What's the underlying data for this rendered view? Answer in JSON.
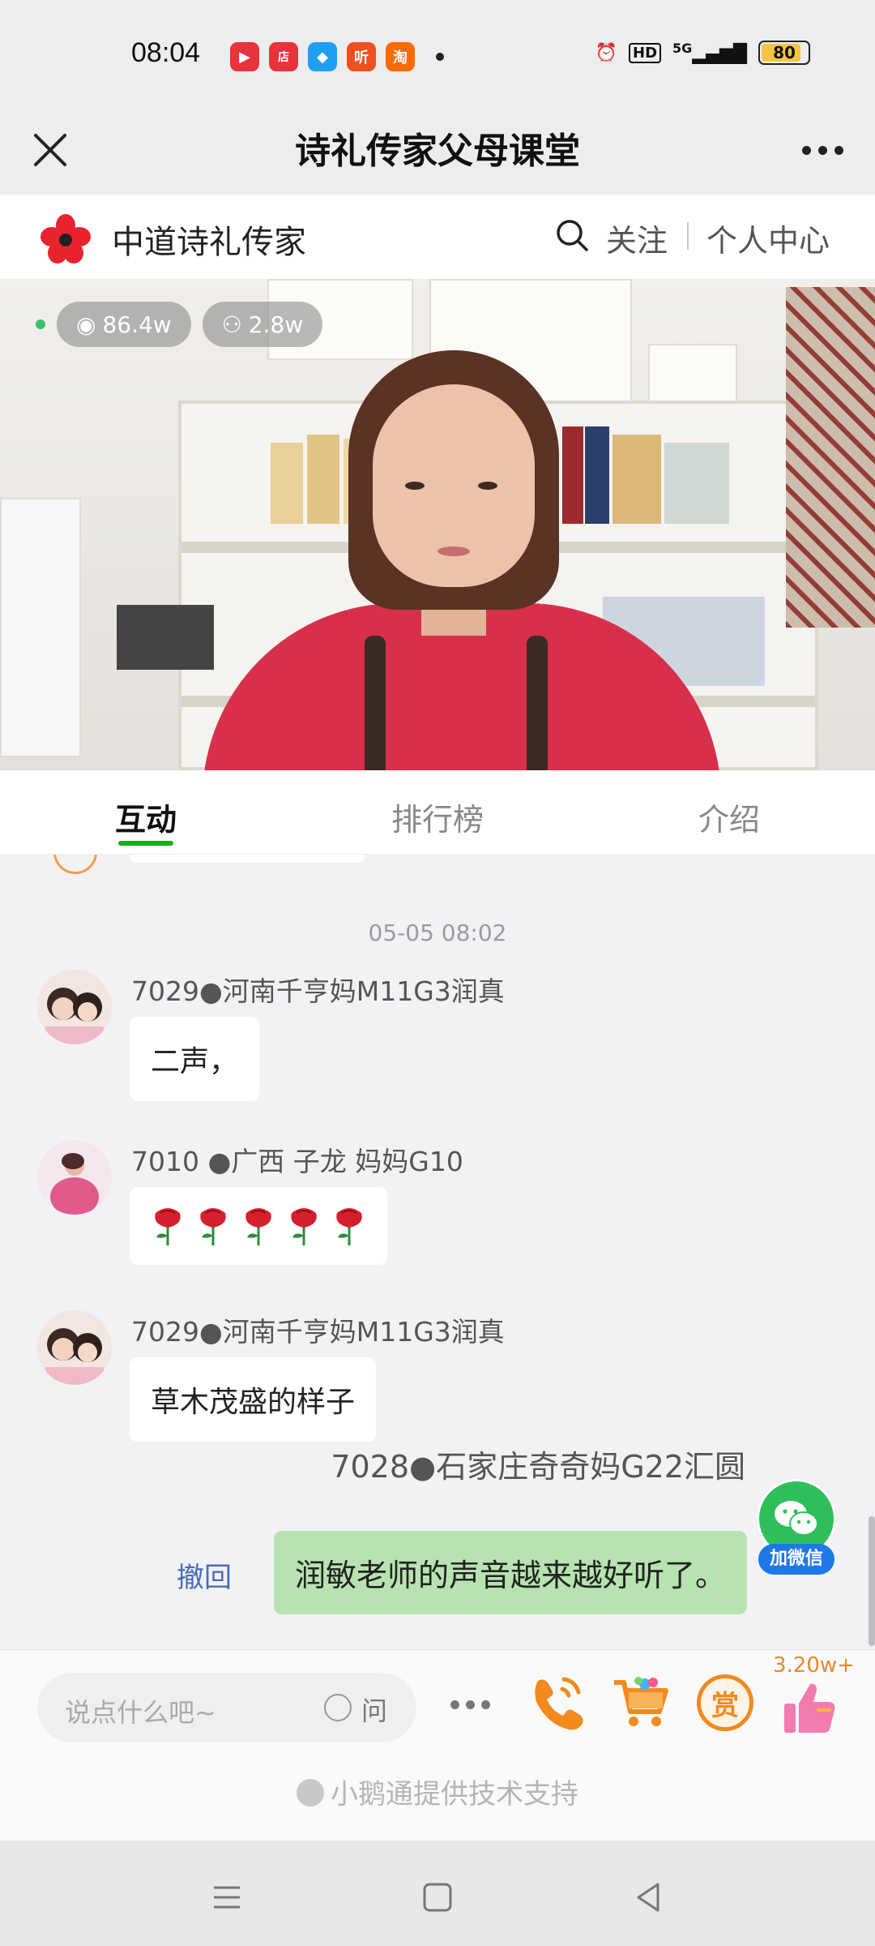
{
  "status_bar": {
    "time": "08:04",
    "app_icons": [
      {
        "icon": "video-app-icon",
        "glyph": "▶",
        "color": "#e8323c"
      },
      {
        "icon": "shop-app-icon",
        "glyph": "店",
        "color": "#e8323c"
      },
      {
        "icon": "qq-icon",
        "glyph": "◆",
        "color": "#1ea0f0"
      },
      {
        "icon": "listen-app-icon",
        "glyph": "听",
        "color": "#f0501e"
      },
      {
        "icon": "taobao-icon",
        "glyph": "淘",
        "color": "#ff6a00"
      }
    ],
    "signal": "5G",
    "hd": "HD",
    "battery": "80"
  },
  "header": {
    "title": "诗礼传家父母课堂"
  },
  "channel": {
    "name": "中道诗礼传家",
    "follow_label": "关注",
    "personal_center_label": "个人中心"
  },
  "video": {
    "heat": "86.4w",
    "viewers": "2.8w"
  },
  "tabs": [
    {
      "label": "互动",
      "active": true
    },
    {
      "label": "排行榜",
      "active": false
    },
    {
      "label": "介绍",
      "active": false
    }
  ],
  "chat": {
    "timestamp": "05-05 08:02",
    "messages": [
      {
        "nick": "7029●河南千亨妈M11G3润真",
        "text": "二声，"
      },
      {
        "nick": "7010 ●广西 子龙 妈妈G10",
        "text": "",
        "emoji_count": 5
      },
      {
        "nick": "7029●河南千亨妈M11G3润真",
        "text": "草木茂盛的样子"
      }
    ],
    "mine": {
      "nick": "7028●石家庄奇奇妈G22汇圆",
      "text": "润敏老师的声音越来越好听了。",
      "recall_label": "撤回"
    },
    "wechat_badge_label": "加微信"
  },
  "input": {
    "placeholder": "说点什么吧~",
    "ask_label": "问",
    "like_count": "3.20w+",
    "reward_label": "赏"
  },
  "footer": {
    "powered_by": "小鹅通提供技术支持"
  },
  "colors": {
    "accent_green": "#1aad19",
    "bubble_mine": "#b7e3b0",
    "link_blue": "#4a6bb8"
  }
}
